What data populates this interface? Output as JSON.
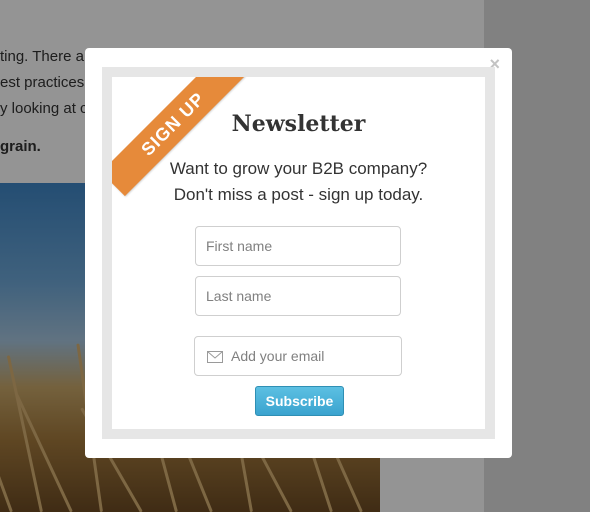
{
  "background": {
    "article_lines": [
      "ting. There a",
      "est practices",
      "y looking at c"
    ],
    "bold_line": "grain.",
    "image": "wheat-field-photo"
  },
  "modal": {
    "close_label": "×",
    "ribbon_label": "SIGN UP",
    "title": "Newsletter",
    "subtitle_lines": [
      "Want to grow your B2B company?",
      "Don't miss a post - sign up today."
    ],
    "fields": {
      "first_name_placeholder": "First name",
      "last_name_placeholder": "Last name",
      "email_placeholder": "Add your email"
    },
    "subscribe_label": "Subscribe",
    "icons": {
      "email": "envelope-icon",
      "close": "close-icon"
    },
    "colors": {
      "ribbon": "#e68a3a",
      "button": "#3aa3cf"
    }
  }
}
